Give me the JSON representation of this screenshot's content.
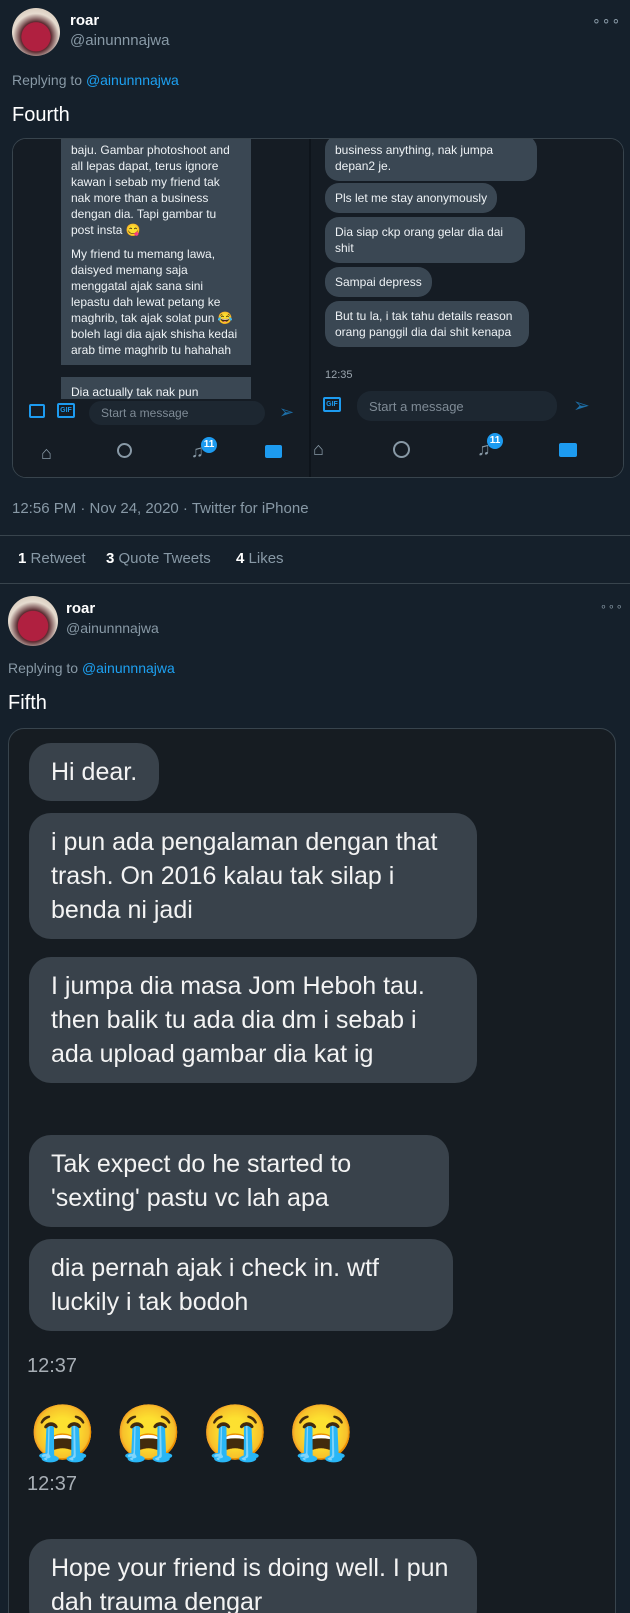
{
  "tweet1": {
    "name": "roar",
    "handle": "@ainunnnajwa",
    "replying_prefix": "Replying to",
    "replying_to": "@ainunnnajwa",
    "text": "Fourth",
    "left_chat": [
      "baju. Gambar photoshoot and all lepas dapat, terus ignore kawan i sebab my friend tak nak more than a business dengan dia. Tapi gambar tu post insta 😋",
      "My friend tu memang lawa, daisyed memang saja menggatal ajak sana sini lepastu dah lewat petang ke maghrib, tak ajak solat pun 😂 boleh lagi dia ajak shisha kedai arab time maghrib tu hahahah",
      "Dia actually tak nak pun"
    ],
    "right_chat": [
      "business anything, nak jumpa depan2 je.",
      "Pls let me stay anonymously",
      "Dia siap ckp orang gelar dia dai shit",
      "Sampai depress",
      "But tu la, i tak tahu details reason orang panggil dia dai shit kenapa"
    ],
    "right_time": "12:35",
    "composer_placeholder": "Start a message",
    "badge_count": "11",
    "timestamp": "12:56 PM · Nov 24, 2020 · Twitter for iPhone",
    "retweets_num": "1",
    "retweets_label": "Retweet",
    "quotes_num": "3",
    "quotes_label": "Quote Tweets",
    "likes_num": "4",
    "likes_label": "Likes"
  },
  "tweet2": {
    "name": "roar",
    "handle": "@ainunnnajwa",
    "replying_prefix": "Replying to",
    "replying_to": "@ainunnnajwa",
    "text": "Fifth",
    "chat": [
      "Hi dear.",
      "i pun ada pengalaman dengan that trash. On 2016 kalau tak silap i benda ni jadi",
      "I jumpa dia masa Jom Heboh tau. then balik tu ada dia dm i sebab i ada upload gambar dia kat ig",
      "Tak expect do he started to 'sexting' pastu vc lah apa",
      "dia pernah ajak i check in. wtf luckily i tak bodoh"
    ],
    "time1": "12:37",
    "emojis": "😭 😭 😭 😭",
    "time2": "12:37",
    "last_msg": "Hope your friend is doing well. I pun dah trauma dengar"
  },
  "colors": {
    "background": "#15202b",
    "link": "#1da1f2",
    "bubble": "#39424b",
    "muted": "#8899a6"
  }
}
